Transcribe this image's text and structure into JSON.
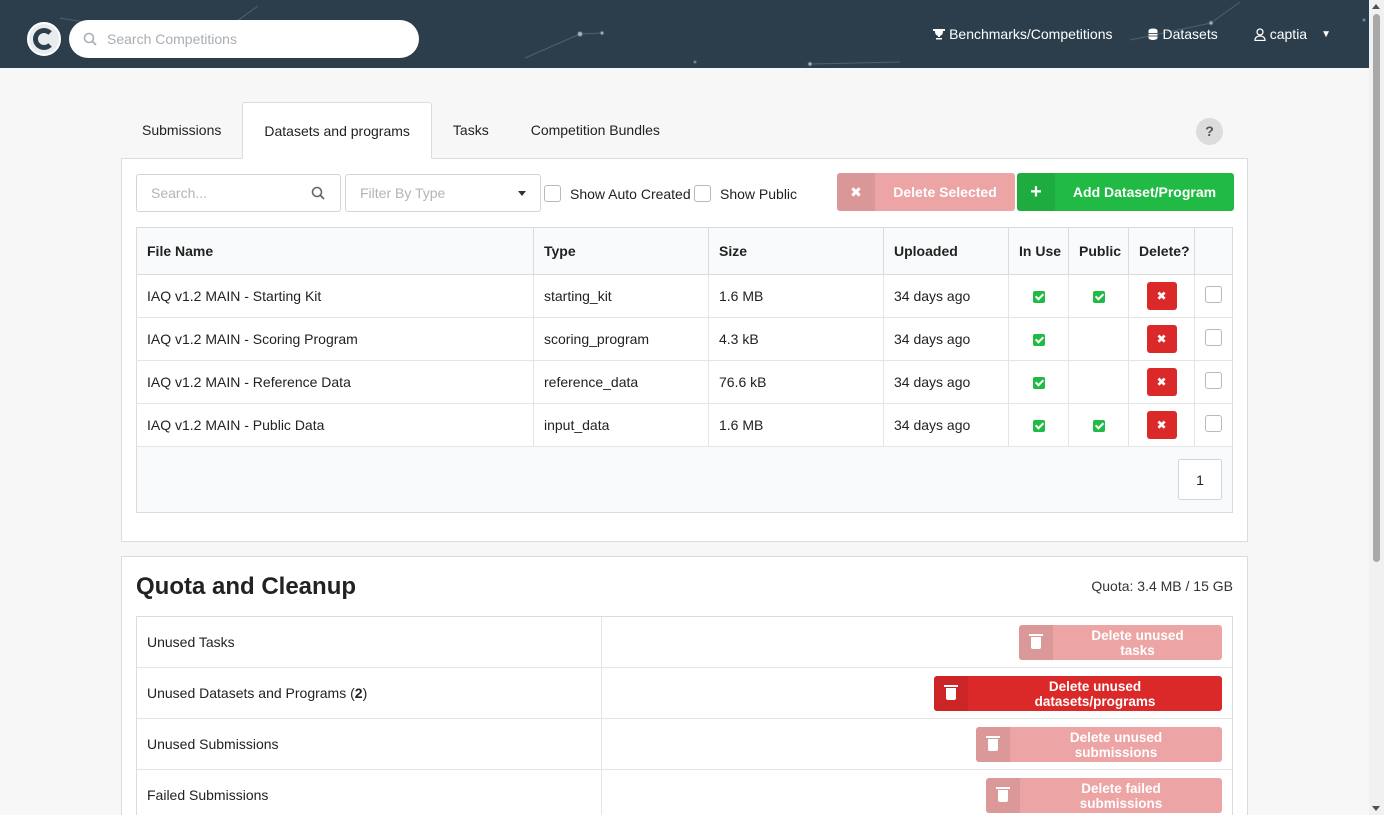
{
  "navbar": {
    "search_placeholder": "Search Competitions",
    "links": [
      {
        "label": "Benchmarks/Competitions",
        "icon": "trophy-icon"
      },
      {
        "label": "Datasets",
        "icon": "database-icon"
      },
      {
        "label": "captia",
        "icon": "user-icon"
      }
    ]
  },
  "tabs": [
    {
      "label": "Submissions",
      "active": false
    },
    {
      "label": "Datasets and programs",
      "active": true
    },
    {
      "label": "Tasks",
      "active": false
    },
    {
      "label": "Competition Bundles",
      "active": false
    }
  ],
  "help_label": "?",
  "toolbar": {
    "search_placeholder": "Search...",
    "filter_placeholder": "Filter By Type",
    "show_auto_created": "Show Auto Created",
    "show_public": "Show Public",
    "delete_selected": "Delete Selected",
    "add_dataset": "Add Dataset/Program"
  },
  "table": {
    "headers": [
      "File Name",
      "Type",
      "Size",
      "Uploaded",
      "In Use",
      "Public",
      "Delete?",
      ""
    ],
    "rows": [
      {
        "name": "IAQ v1.2 MAIN - Starting Kit",
        "type": "starting_kit",
        "size": "1.6 MB",
        "uploaded": "34 days ago",
        "in_use": true,
        "public": true
      },
      {
        "name": "IAQ v1.2 MAIN - Scoring Program",
        "type": "scoring_program",
        "size": "4.3 kB",
        "uploaded": "34 days ago",
        "in_use": true,
        "public": false
      },
      {
        "name": "IAQ v1.2 MAIN - Reference Data",
        "type": "reference_data",
        "size": "76.6 kB",
        "uploaded": "34 days ago",
        "in_use": true,
        "public": false
      },
      {
        "name": "IAQ v1.2 MAIN - Public Data",
        "type": "input_data",
        "size": "1.6 MB",
        "uploaded": "34 days ago",
        "in_use": true,
        "public": true
      }
    ],
    "page": "1"
  },
  "quota": {
    "title": "Quota and Cleanup",
    "info": "Quota: 3.4 MB / 15 GB",
    "rows": [
      {
        "label": "Unused Tasks",
        "count": "",
        "button": "Delete unused tasks",
        "enabled": false
      },
      {
        "label": "Unused Datasets and Programs (",
        "count": "2",
        "suffix": ")",
        "button": "Delete unused datasets/programs",
        "enabled": true
      },
      {
        "label": "Unused Submissions",
        "count": "",
        "button": "Delete unused submissions",
        "enabled": false
      },
      {
        "label": "Failed Submissions",
        "count": "",
        "button": "Delete failed submissions",
        "enabled": false
      }
    ]
  }
}
